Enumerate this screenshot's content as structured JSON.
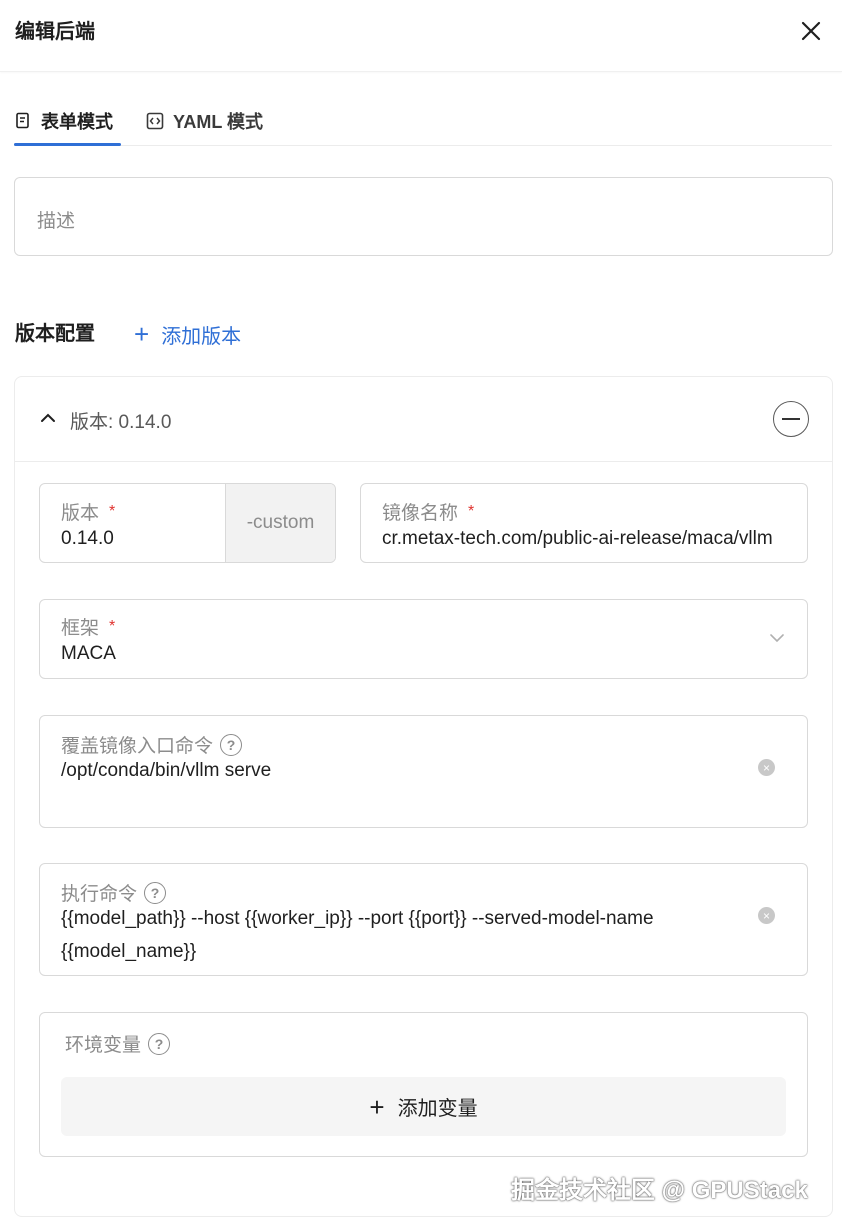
{
  "header": {
    "title": "编辑后端"
  },
  "tabs": [
    {
      "label": "表单模式",
      "active": true
    },
    {
      "label": "YAML 模式",
      "active": false
    }
  ],
  "description": {
    "placeholder": "描述"
  },
  "version_config": {
    "title": "版本配置",
    "add_label": "添加版本",
    "version_card": {
      "header": "版本: 0.14.0",
      "version_field": {
        "label": "版本",
        "value": "0.14.0",
        "suffix": "-custom"
      },
      "image_field": {
        "label": "镜像名称",
        "value": "cr.metax-tech.com/public-ai-release/maca/vllm"
      },
      "framework_field": {
        "label": "框架",
        "value": "MACA"
      },
      "entrypoint_field": {
        "label": "覆盖镜像入口命令",
        "value": "/opt/conda/bin/vllm serve"
      },
      "command_field": {
        "label": "执行命令",
        "value_line1": "{{model_path}} --host {{worker_ip}} --port {{port}} --served-model-name",
        "value_line2": "{{model_name}}"
      },
      "env_field": {
        "label": "环境变量",
        "add_label": "添加变量"
      }
    }
  },
  "watermark": "掘金技术社区 @ GPUStack",
  "colors": {
    "accent": "#2f6fd6",
    "required": "#e0332f",
    "addon_bg": "#f2f2f2"
  },
  "icons": {
    "close": "close-icon",
    "form": "form-icon",
    "yaml": "code-icon",
    "collapse": "chevron-up-icon",
    "remove": "minus-circle-icon",
    "select": "chevron-down-icon",
    "help": "question-circle-icon",
    "clear": "clear-circle-icon",
    "add": "plus-icon"
  }
}
